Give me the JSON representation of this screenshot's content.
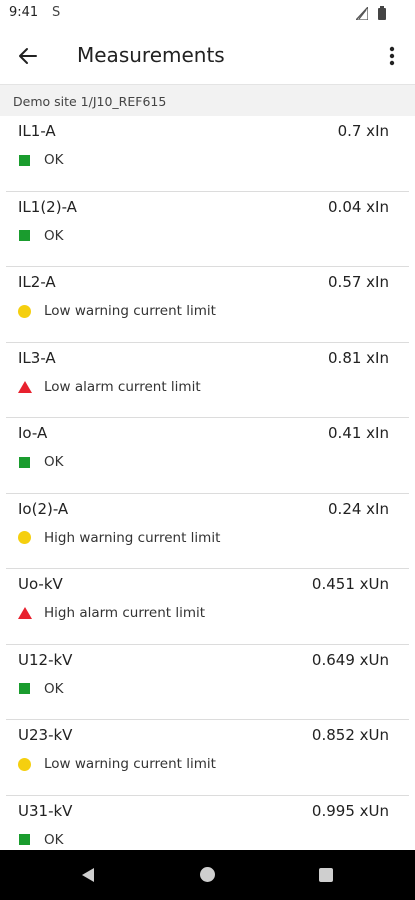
{
  "status_bar": {
    "time": "9:41",
    "sim_icon": "S"
  },
  "app_bar": {
    "title": "Measurements",
    "back_icon": "arrow-left",
    "menu_icon": "more-vertical"
  },
  "breadcrumb": "Demo site 1/J10_REF615",
  "colors": {
    "ok": "#1a9c2e",
    "warning": "#f5cf0f",
    "alarm": "#e8212e"
  },
  "measurements": [
    {
      "name": "IL1-A",
      "value": "0.7 xIn",
      "status": "ok",
      "status_text": "OK"
    },
    {
      "name": "IL1(2)-A",
      "value": "0.04 xIn",
      "status": "ok",
      "status_text": "OK"
    },
    {
      "name": "IL2-A",
      "value": "0.57 xIn",
      "status": "warning",
      "status_text": "Low warning current limit"
    },
    {
      "name": "IL3-A",
      "value": "0.81 xIn",
      "status": "alarm",
      "status_text": "Low alarm current limit"
    },
    {
      "name": "Io-A",
      "value": "0.41 xIn",
      "status": "ok",
      "status_text": "OK"
    },
    {
      "name": "Io(2)-A",
      "value": "0.24 xIn",
      "status": "warning",
      "status_text": "High warning current limit"
    },
    {
      "name": "Uo-kV",
      "value": "0.451 xUn",
      "status": "alarm",
      "status_text": "High alarm current limit"
    },
    {
      "name": "U12-kV",
      "value": "0.649 xUn",
      "status": "ok",
      "status_text": "OK"
    },
    {
      "name": "U23-kV",
      "value": "0.852 xUn",
      "status": "warning",
      "status_text": "Low warning current limit"
    },
    {
      "name": "U31-kV",
      "value": "0.995 xUn",
      "status": "ok",
      "status_text": "OK"
    }
  ]
}
